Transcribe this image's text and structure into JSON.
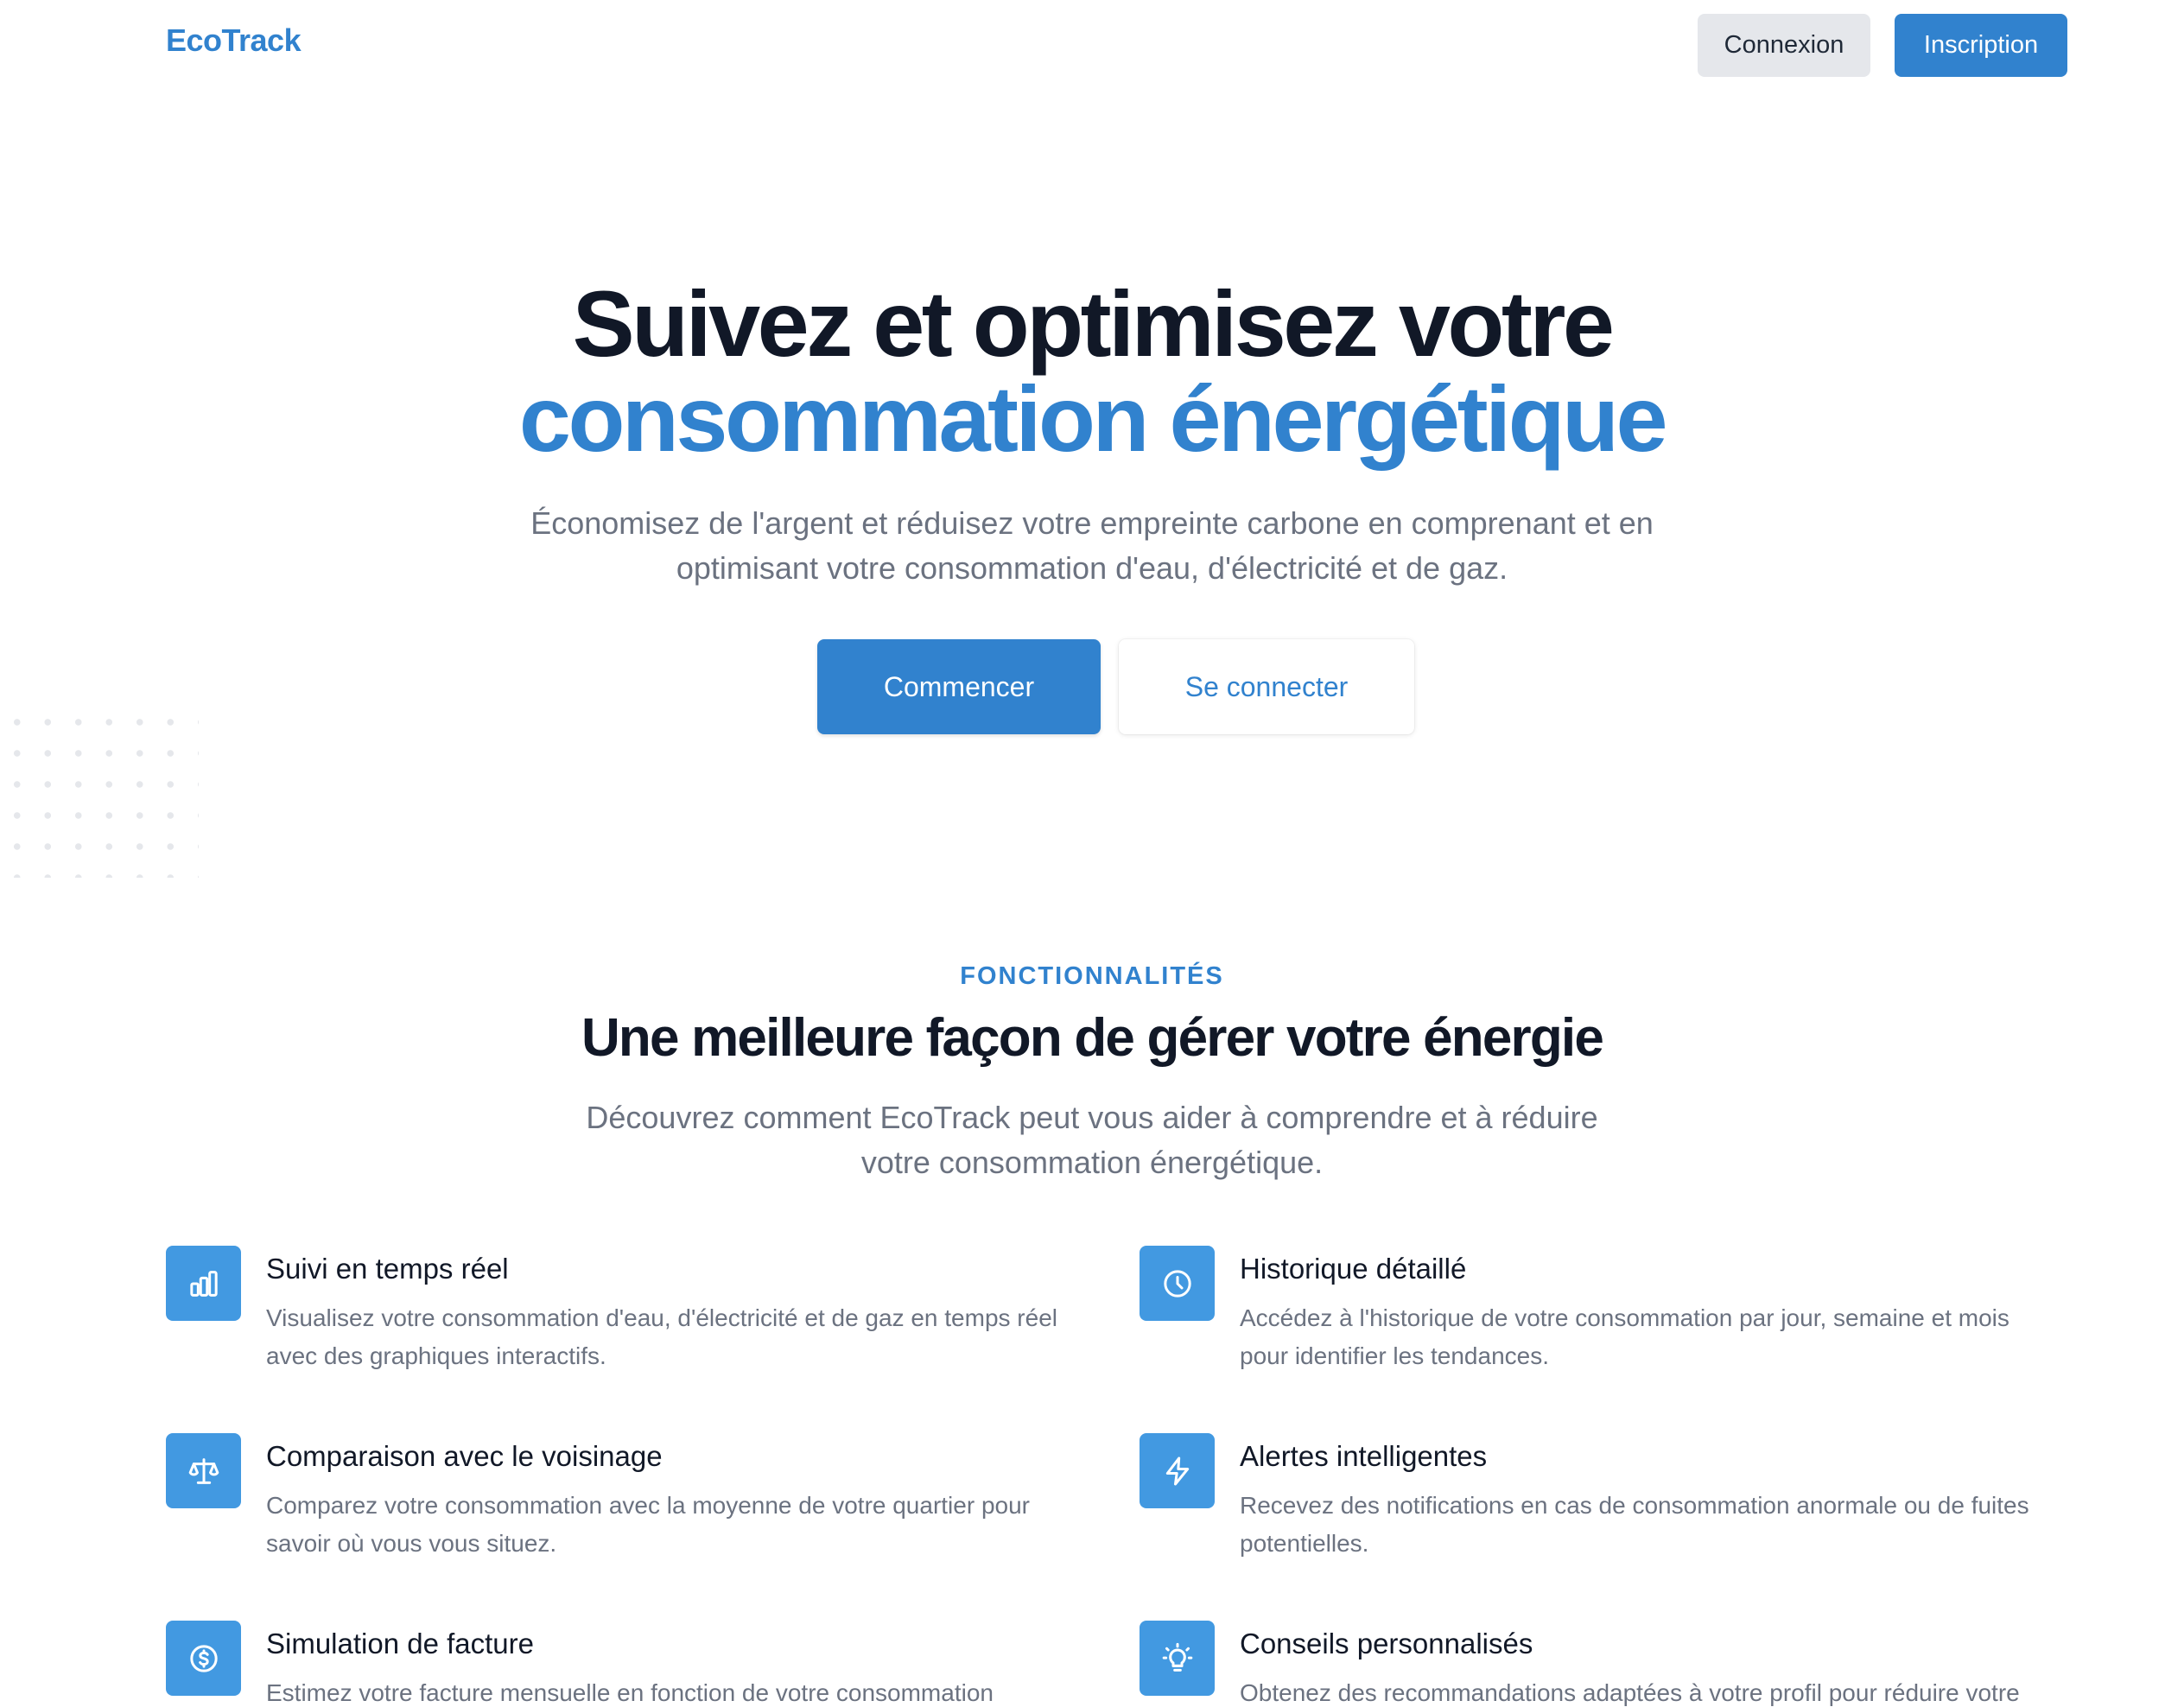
{
  "header": {
    "brand": "EcoTrack",
    "login_label": "Connexion",
    "signup_label": "Inscription"
  },
  "hero": {
    "title_line1": "Suivez et optimisez votre",
    "title_line2": "consommation énergétique",
    "subtitle": "Économisez de l'argent et réduisez votre empreinte carbone en comprenant et en optimisant votre consommation d'eau, d'électricité et de gaz.",
    "primary_cta": "Commencer",
    "secondary_cta": "Se connecter"
  },
  "features": {
    "eyebrow": "FONCTIONNALITÉS",
    "title": "Une meilleure façon de gérer votre énergie",
    "subtitle": "Découvrez comment EcoTrack peut vous aider à comprendre et à réduire votre consommation énergétique.",
    "items": [
      {
        "icon": "bar-chart-icon",
        "title": "Suivi en temps réel",
        "description": "Visualisez votre consommation d'eau, d'électricité et de gaz en temps réel avec des graphiques interactifs."
      },
      {
        "icon": "clock-icon",
        "title": "Historique détaillé",
        "description": "Accédez à l'historique de votre consommation par jour, semaine et mois pour identifier les tendances."
      },
      {
        "icon": "scale-icon",
        "title": "Comparaison avec le voisinage",
        "description": "Comparez votre consommation avec la moyenne de votre quartier pour savoir où vous vous situez."
      },
      {
        "icon": "lightning-icon",
        "title": "Alertes intelligentes",
        "description": "Recevez des notifications en cas de consommation anormale ou de fuites potentielles."
      },
      {
        "icon": "dollar-circle-icon",
        "title": "Simulation de facture",
        "description": "Estimez votre facture mensuelle en fonction de votre consommation"
      },
      {
        "icon": "lightbulb-icon",
        "title": "Conseils personnalisés",
        "description": "Obtenez des recommandations adaptées à votre profil pour réduire votre"
      }
    ]
  },
  "colors": {
    "accent": "#3182ce",
    "icon_bg": "#4299e1",
    "heading": "#111827",
    "muted": "#6b7280",
    "secondary_button": "#e5e7eb"
  }
}
